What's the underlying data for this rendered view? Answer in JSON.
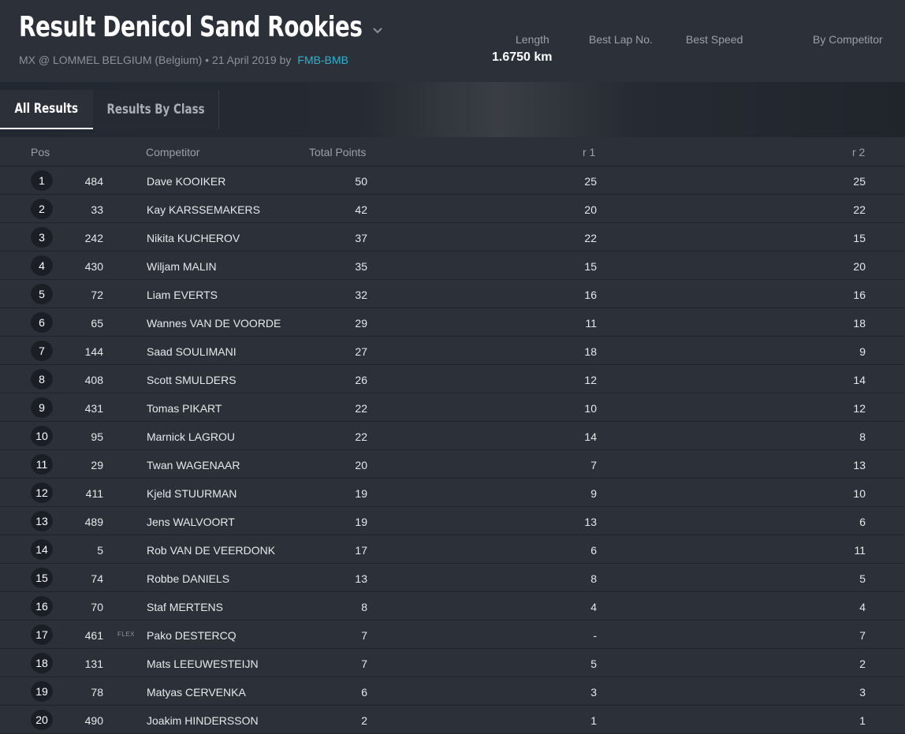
{
  "header": {
    "title": "Result Denicol Sand Rookies",
    "subtitle_prefix": "MX @ LOMMEL BELGIUM (Belgium) • 21 April 2019 by",
    "organizer": "FMB-BMB",
    "stats": {
      "length_label": "Length",
      "length_value": "1.6750 km",
      "best_lap_label": "Best Lap No.",
      "best_speed_label": "Best Speed",
      "by_competitor_label": "By Competitor"
    }
  },
  "tabs": [
    {
      "label": "All Results",
      "active": true
    },
    {
      "label": "Results By Class",
      "active": false
    }
  ],
  "table": {
    "headers": {
      "pos": "Pos",
      "competitor": "Competitor",
      "total": "Total Points",
      "r1": "r 1",
      "r2": "r 2"
    },
    "rows": [
      {
        "pos": "1",
        "num": "484",
        "tag": "",
        "name": "Dave KOOIKER",
        "total": "50",
        "r1": "25",
        "r2": "25"
      },
      {
        "pos": "2",
        "num": "33",
        "tag": "",
        "name": "Kay KARSSEMAKERS",
        "total": "42",
        "r1": "20",
        "r2": "22"
      },
      {
        "pos": "3",
        "num": "242",
        "tag": "",
        "name": "Nikita KUCHEROV",
        "total": "37",
        "r1": "22",
        "r2": "15"
      },
      {
        "pos": "4",
        "num": "430",
        "tag": "",
        "name": "Wiljam MALIN",
        "total": "35",
        "r1": "15",
        "r2": "20"
      },
      {
        "pos": "5",
        "num": "72",
        "tag": "",
        "name": "Liam EVERTS",
        "total": "32",
        "r1": "16",
        "r2": "16"
      },
      {
        "pos": "6",
        "num": "65",
        "tag": "",
        "name": "Wannes VAN DE VOORDE",
        "total": "29",
        "r1": "11",
        "r2": "18"
      },
      {
        "pos": "7",
        "num": "144",
        "tag": "",
        "name": "Saad SOULIMANI",
        "total": "27",
        "r1": "18",
        "r2": "9"
      },
      {
        "pos": "8",
        "num": "408",
        "tag": "",
        "name": "Scott SMULDERS",
        "total": "26",
        "r1": "12",
        "r2": "14"
      },
      {
        "pos": "9",
        "num": "431",
        "tag": "",
        "name": "Tomas PIKART",
        "total": "22",
        "r1": "10",
        "r2": "12"
      },
      {
        "pos": "10",
        "num": "95",
        "tag": "",
        "name": "Marnick LAGROU",
        "total": "22",
        "r1": "14",
        "r2": "8"
      },
      {
        "pos": "11",
        "num": "29",
        "tag": "",
        "name": "Twan WAGENAAR",
        "total": "20",
        "r1": "7",
        "r2": "13"
      },
      {
        "pos": "12",
        "num": "411",
        "tag": "",
        "name": "Kjeld STUURMAN",
        "total": "19",
        "r1": "9",
        "r2": "10"
      },
      {
        "pos": "13",
        "num": "489",
        "tag": "",
        "name": "Jens WALVOORT",
        "total": "19",
        "r1": "13",
        "r2": "6"
      },
      {
        "pos": "14",
        "num": "5",
        "tag": "",
        "name": "Rob VAN DE VEERDONK",
        "total": "17",
        "r1": "6",
        "r2": "11"
      },
      {
        "pos": "15",
        "num": "74",
        "tag": "",
        "name": "Robbe DANIELS",
        "total": "13",
        "r1": "8",
        "r2": "5"
      },
      {
        "pos": "16",
        "num": "70",
        "tag": "",
        "name": "Staf MERTENS",
        "total": "8",
        "r1": "4",
        "r2": "4"
      },
      {
        "pos": "17",
        "num": "461",
        "tag": "FLEX",
        "name": "Pako DESTERCQ",
        "total": "7",
        "r1": "-",
        "r2": "7"
      },
      {
        "pos": "18",
        "num": "131",
        "tag": "",
        "name": "Mats LEEUWESTEIJN",
        "total": "7",
        "r1": "5",
        "r2": "2"
      },
      {
        "pos": "19",
        "num": "78",
        "tag": "",
        "name": "Matyas CERVENKA",
        "total": "6",
        "r1": "3",
        "r2": "3"
      },
      {
        "pos": "20",
        "num": "490",
        "tag": "",
        "name": "Joakim HINDERSSON",
        "total": "2",
        "r1": "1",
        "r2": "1"
      }
    ]
  }
}
